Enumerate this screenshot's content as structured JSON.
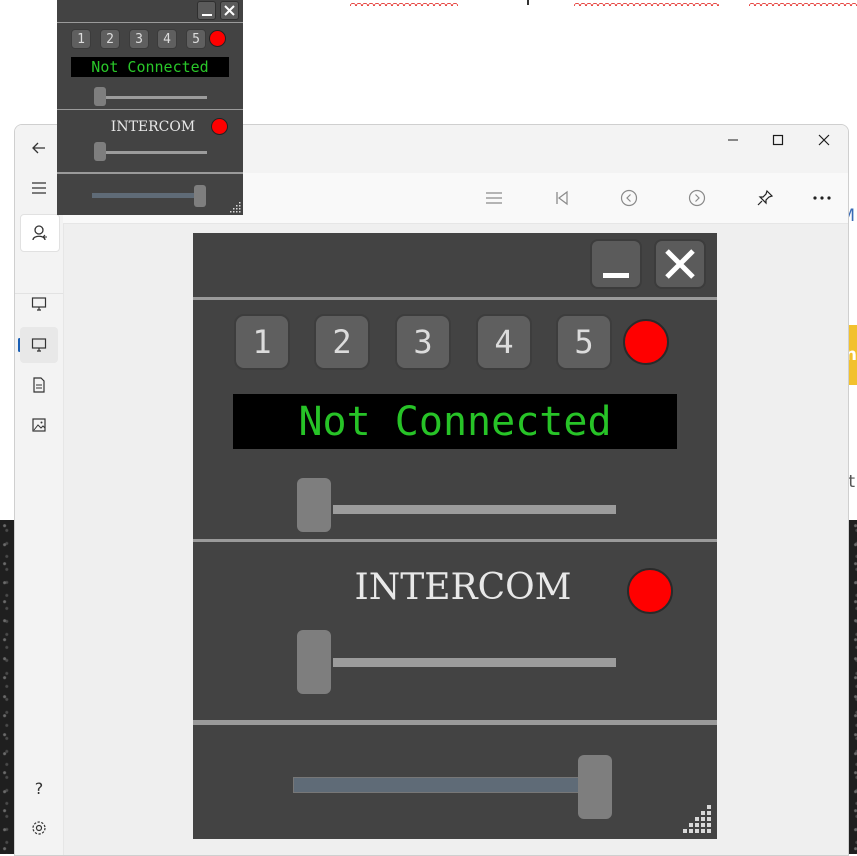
{
  "radio_panel": {
    "channels": [
      "1",
      "2",
      "3",
      "4",
      "5"
    ],
    "status_text": "Not Connected",
    "intercom_label": "INTERCOM",
    "led_color": "#ff0000",
    "status_text_color": "#27c327",
    "panel_color": "#434343",
    "radio_volume_level": 0.0,
    "intercom_volume_level": 0.0,
    "master_slider_level": 1.0
  },
  "viewer_window": {
    "toolbar_icons": [
      "list-icon",
      "first-page-icon",
      "previous-icon",
      "next-icon",
      "pin-icon",
      "more-icon"
    ],
    "sidebar_icons": [
      "back-arrow-icon",
      "hamburger-menu-icon",
      "person-icon",
      "monitor-icon",
      "monitor-icon",
      "document-icon",
      "image-icon",
      "help-icon",
      "settings-icon"
    ],
    "help_label": "?",
    "window_controls": [
      "minimize-icon",
      "maximize-icon",
      "close-icon"
    ]
  },
  "background": {
    "edge_text_1": "M",
    "edge_text_2": "t",
    "edge_text_3": "n"
  }
}
